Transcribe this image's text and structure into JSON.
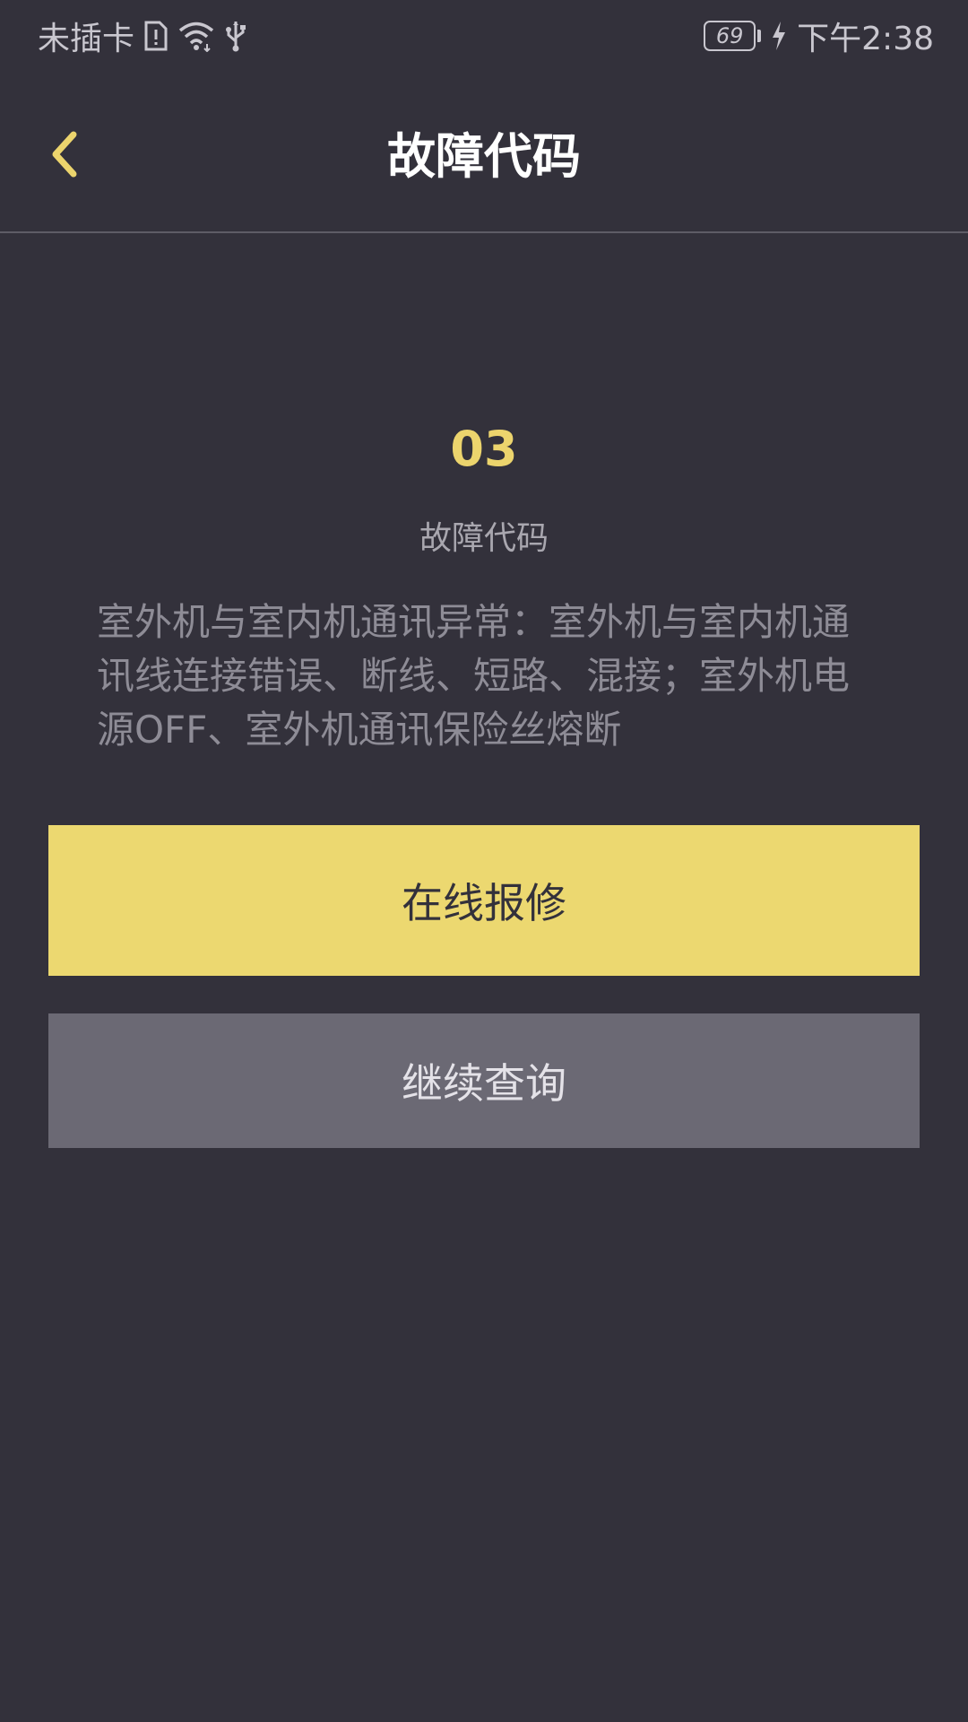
{
  "status_bar": {
    "carrier": "未插卡",
    "battery_level": "69",
    "time": "下午2:38"
  },
  "header": {
    "title": "故障代码"
  },
  "fault": {
    "code": "03",
    "label": "故障代码",
    "description": "室外机与室内机通讯异常：室外机与室内机通讯线连接错误、断线、短路、混接；室外机电源OFF、室外机通讯保险丝熔断"
  },
  "actions": {
    "repair_label": "在线报修",
    "continue_label": "继续查询"
  },
  "colors": {
    "background": "#33313b",
    "accent": "#ecd870",
    "secondary_button": "#6b6974"
  },
  "icons": {
    "sim": "sim-card-icon",
    "wifi": "wifi-icon",
    "usb": "usb-icon",
    "charging": "charging-bolt-icon",
    "back": "chevron-left-icon"
  }
}
